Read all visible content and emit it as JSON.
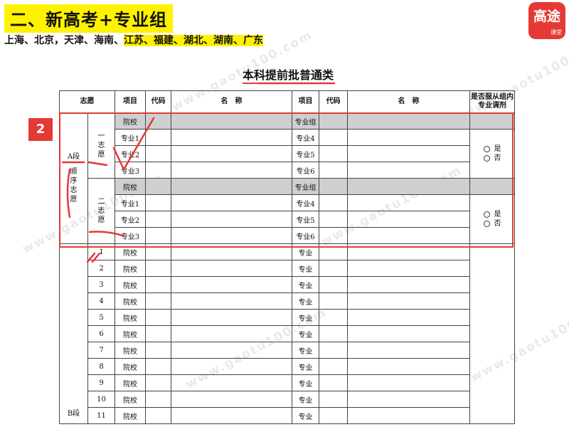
{
  "header": {
    "title": "二、新高考+专业组",
    "subtitle_plain": "上海、北京，天津、海南、",
    "subtitle_highlight": "江苏、福建、湖北、湖南、广东"
  },
  "logo": {
    "text": "高途",
    "sub": "课堂"
  },
  "watermark": "www.gaotu100.com",
  "form_title": "本科提前批普通类",
  "badge": "2",
  "table": {
    "headers": {
      "zhiyuan": "志愿",
      "xiangmu1": "项目",
      "daima1": "代码",
      "mingcheng1": "名　称",
      "xiangmu2": "项目",
      "daima2": "代码",
      "mingcheng2": "名　称",
      "fucong": "是否服从组内专业调剂"
    },
    "section_a": {
      "label": "A段",
      "order_label": "顺序志愿",
      "group1": {
        "label": "一志愿",
        "left_rows": [
          "院校",
          "专业1",
          "专业2",
          "专业3"
        ],
        "right_rows": [
          "专业组",
          "专业4",
          "专业5",
          "专业6"
        ]
      },
      "group2": {
        "label": "二志愿",
        "left_rows": [
          "院校",
          "专业1",
          "专业2",
          "专业3"
        ],
        "right_rows": [
          "专业组",
          "专业4",
          "专业5",
          "专业6"
        ]
      },
      "options": {
        "yes": "是",
        "no": "否"
      }
    },
    "section_b": {
      "label": "B段",
      "rows": [
        {
          "num": "1",
          "left": "院校",
          "right": "专业"
        },
        {
          "num": "2",
          "left": "院校",
          "right": "专业"
        },
        {
          "num": "3",
          "left": "院校",
          "right": "专业"
        },
        {
          "num": "4",
          "left": "院校",
          "right": "专业"
        },
        {
          "num": "5",
          "left": "院校",
          "right": "专业"
        },
        {
          "num": "6",
          "left": "院校",
          "right": "专业"
        },
        {
          "num": "7",
          "left": "院校",
          "right": "专业"
        },
        {
          "num": "8",
          "left": "院校",
          "right": "专业"
        },
        {
          "num": "9",
          "left": "院校",
          "right": "专业"
        },
        {
          "num": "10",
          "left": "院校",
          "right": "专业"
        },
        {
          "num": "11",
          "left": "院校",
          "right": "专业"
        }
      ]
    }
  },
  "colors": {
    "highlight": "#fff200",
    "accent_red": "#e53935",
    "gray_row": "#cfcfcf"
  }
}
